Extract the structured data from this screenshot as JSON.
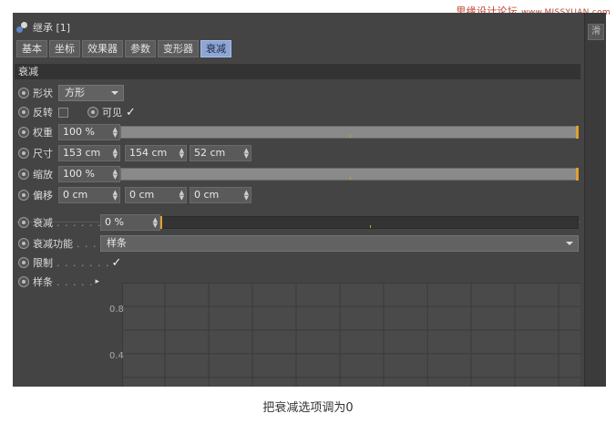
{
  "watermark": {
    "text": "思缘设计论坛",
    "url": "www.MISSYUAN.com"
  },
  "window": {
    "title": "继承 [1]",
    "side_tab": "滑"
  },
  "tabs": [
    {
      "label": "基本"
    },
    {
      "label": "坐标"
    },
    {
      "label": "效果器"
    },
    {
      "label": "参数"
    },
    {
      "label": "变形器"
    },
    {
      "label": "衰减",
      "active": true
    }
  ],
  "section": {
    "title": "衰减"
  },
  "fields": {
    "shape": {
      "label": "形状",
      "value": "方形"
    },
    "invert": {
      "label": "反转",
      "checked": false
    },
    "visible": {
      "label": "可见",
      "checked": true,
      "mark": "✓"
    },
    "weight": {
      "label": "权重",
      "value": "100 %",
      "level": 1.0
    },
    "size": {
      "label": "尺寸",
      "x": "153 cm",
      "y": "154 cm",
      "z": "52 cm"
    },
    "scale": {
      "label": "缩放",
      "value": "100 %",
      "level": 1.0
    },
    "offset": {
      "label": "偏移",
      "x": "0 cm",
      "y": "0 cm",
      "z": "0 cm"
    },
    "falloff": {
      "label": "衰减",
      "dots": ". . . . . . .",
      "value": "0 %",
      "level": 0.0
    },
    "falloff_function": {
      "label": "衰减功能",
      "dots": ". . . .",
      "value": "样条"
    },
    "clamp": {
      "label": "限制",
      "dots": ". . . . . . .",
      "checked": true,
      "mark": "✓"
    },
    "spline": {
      "label": "样条",
      "dots": ". . . . .",
      "arrow": "▸"
    }
  },
  "graph": {
    "y_ticks": [
      "0.8",
      "0.4"
    ]
  },
  "caption": "把衰减选项调为0",
  "colors": {
    "panel": "#444444",
    "active_tab": "#8ea6d6",
    "accent": "#e0a030"
  }
}
